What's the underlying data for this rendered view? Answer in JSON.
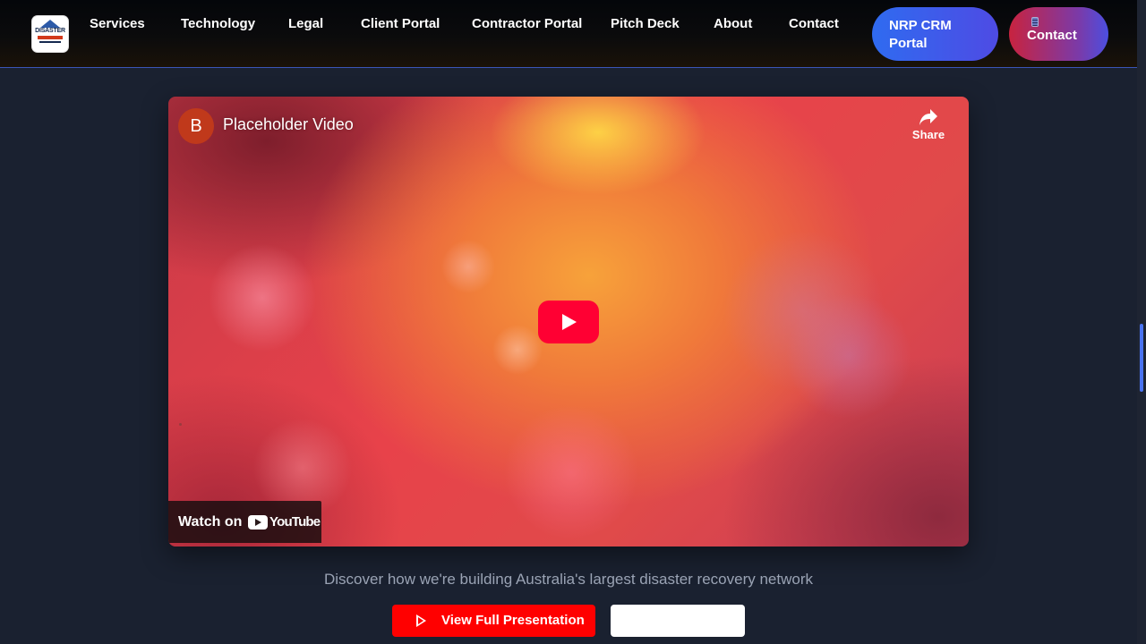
{
  "nav": {
    "logo_text": "DISASTER",
    "links": [
      {
        "label": "Services"
      },
      {
        "label": "Technology"
      },
      {
        "label": "Legal"
      },
      {
        "label": "Client Portal"
      },
      {
        "label": "Contractor Portal"
      },
      {
        "label": "Pitch Deck"
      },
      {
        "label": "About"
      },
      {
        "label": "Contact"
      }
    ],
    "crm_button": {
      "line1": "NRP CRM",
      "line2": "Portal"
    },
    "contact_button": {
      "label": "Contact",
      "icon": "phone-icon"
    }
  },
  "video": {
    "channel_initial": "B",
    "title": "Placeholder Video",
    "share_label": "Share",
    "watch_on": "Watch on",
    "youtube_word": "YouTube",
    "colors": {
      "play_button": "#ff0033"
    }
  },
  "tagline": "Discover how we're building Australia's largest disaster recovery network",
  "actions": {
    "view_presentation": "View Full Presentation",
    "secondary": ""
  },
  "colors": {
    "background": "#1a2130",
    "accent_blue": "#2f6bf0",
    "accent_red": "#ff0000"
  }
}
